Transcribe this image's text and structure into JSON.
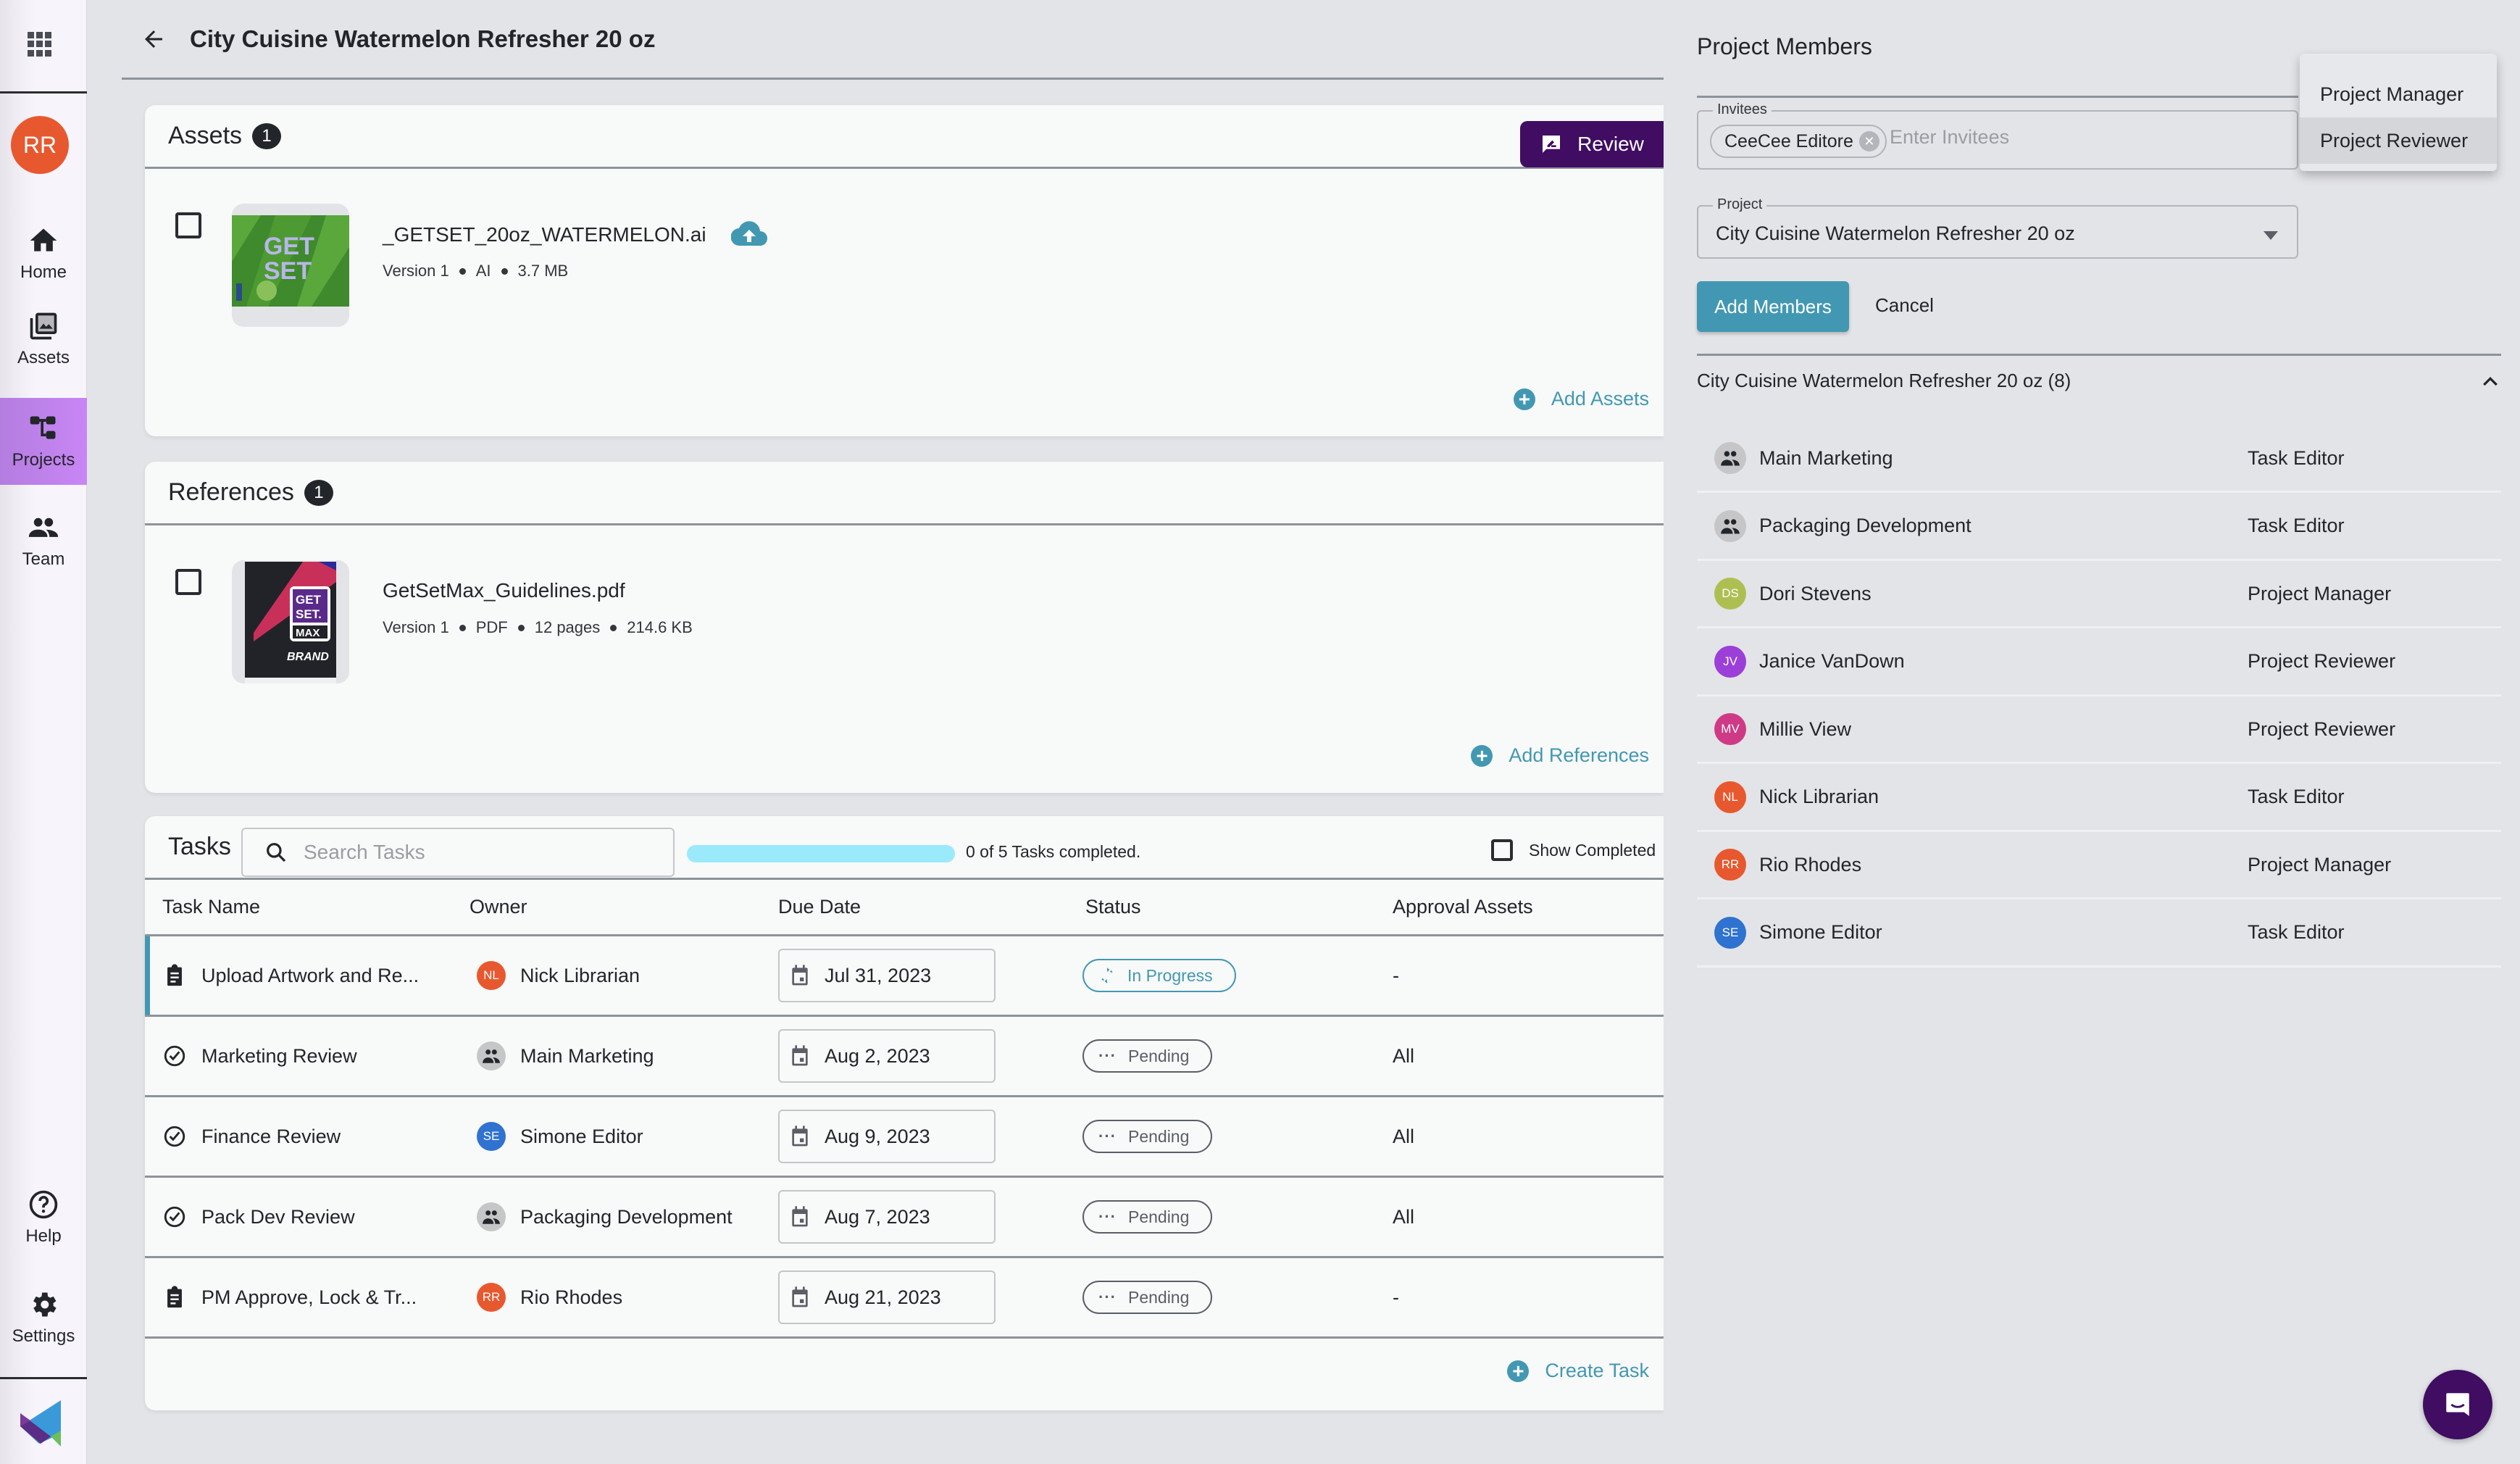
{
  "sidebar": {
    "user_initials": "RR",
    "user_color": "#e8582e",
    "items": [
      {
        "label": "Home",
        "icon": "home-icon"
      },
      {
        "label": "Assets",
        "icon": "images-icon"
      },
      {
        "label": "Projects",
        "icon": "project-tree-icon",
        "active": true
      },
      {
        "label": "Team",
        "icon": "team-icon"
      },
      {
        "label": "Help",
        "icon": "help-icon"
      },
      {
        "label": "Settings",
        "icon": "gear-icon"
      }
    ],
    "accent": "#c886f5"
  },
  "header": {
    "title": "City Cuisine Watermelon Refresher 20 oz"
  },
  "assets": {
    "title": "Assets",
    "count": "1",
    "review_label": "Review",
    "items": [
      {
        "name": "_GETSET_20oz_WATERMELON.ai",
        "meta": [
          "Version 1",
          "AI",
          "3.7 MB"
        ],
        "thumb_text": "GET SET"
      }
    ],
    "add_label": "Add Assets"
  },
  "references": {
    "title": "References",
    "count": "1",
    "items": [
      {
        "name": "GetSetMax_Guidelines.pdf",
        "meta": [
          "Version 1",
          "PDF",
          "12 pages",
          "214.6 KB"
        ],
        "thumb_text": [
          "GET",
          "SET.",
          "MAX",
          "BRAND"
        ]
      }
    ],
    "add_label": "Add References"
  },
  "tasks": {
    "title": "Tasks",
    "search_placeholder": "Search Tasks",
    "search_value": "",
    "completed": 0,
    "total": 5,
    "progress_text": "0 of 5 Tasks completed.",
    "show_completed_label": "Show Completed",
    "columns": [
      "Task Name",
      "Owner",
      "Due Date",
      "Status",
      "Approval Assets"
    ],
    "rows": [
      {
        "name": "Upload Artwork and Re...",
        "icon": "clipboard-icon",
        "owner": "Nick Librarian",
        "owner_initials": "NL",
        "owner_color": "#e8582e",
        "owner_group": false,
        "due": "Jul 31, 2023",
        "status": "In Progress",
        "approval": "-",
        "active": true
      },
      {
        "name": "Marketing Review",
        "icon": "check-circle-icon",
        "owner": "Main Marketing",
        "owner_initials": "",
        "owner_color": "#c6c6c8",
        "owner_group": true,
        "due": "Aug 2, 2023",
        "status": "Pending",
        "approval": "All"
      },
      {
        "name": "Finance Review",
        "icon": "check-circle-icon",
        "owner": "Simone Editor",
        "owner_initials": "SE",
        "owner_color": "#2f72d0",
        "owner_group": false,
        "due": "Aug 9, 2023",
        "status": "Pending",
        "approval": "All"
      },
      {
        "name": "Pack Dev Review",
        "icon": "check-circle-icon",
        "owner": "Packaging Development",
        "owner_initials": "",
        "owner_color": "#c6c6c8",
        "owner_group": true,
        "due": "Aug 7, 2023",
        "status": "Pending",
        "approval": "All"
      },
      {
        "name": "PM Approve, Lock & Tr...",
        "icon": "clipboard-icon",
        "owner": "Rio Rhodes",
        "owner_initials": "RR",
        "owner_color": "#e8582e",
        "owner_group": false,
        "due": "Aug 21, 2023",
        "status": "Pending",
        "approval": "-"
      }
    ],
    "create_label": "Create Task"
  },
  "panel": {
    "title": "Project Members",
    "invitees_label": "Invitees",
    "invitee_chip": "CeeCee Editore",
    "invitees_placeholder": "Enter Invitees",
    "project_label": "Project",
    "project_value": "City Cuisine Watermelon Refresher 20 oz",
    "add_members_label": "Add Members",
    "cancel_label": "Cancel",
    "role_menu": [
      "Project Manager",
      "Project Reviewer"
    ],
    "role_menu_hover": "Project Reviewer",
    "group_title": "City Cuisine Watermelon Refresher 20 oz (8)",
    "members": [
      {
        "name": "Main Marketing",
        "initials": "",
        "color": "#c6c6c8",
        "group": true,
        "role": "Task Editor"
      },
      {
        "name": "Packaging Development",
        "initials": "",
        "color": "#c6c6c8",
        "group": true,
        "role": "Task Editor"
      },
      {
        "name": "Dori Stevens",
        "initials": "DS",
        "color": "#aebf52",
        "group": false,
        "role": "Project Manager"
      },
      {
        "name": "Janice VanDown",
        "initials": "JV",
        "color": "#9b3fd8",
        "group": false,
        "role": "Project Reviewer"
      },
      {
        "name": "Millie View",
        "initials": "MV",
        "color": "#cf3a86",
        "group": false,
        "role": "Project Reviewer"
      },
      {
        "name": "Nick Librarian",
        "initials": "NL",
        "color": "#e8582e",
        "group": false,
        "role": "Task Editor"
      },
      {
        "name": "Rio Rhodes",
        "initials": "RR",
        "color": "#e8582e",
        "group": false,
        "role": "Project Manager"
      },
      {
        "name": "Simone Editor",
        "initials": "SE",
        "color": "#2f72d0",
        "group": false,
        "role": "Task Editor"
      }
    ]
  },
  "colors": {
    "brand_purple": "#400d63",
    "accent_teal": "#4298b2",
    "progress_track": "#9aeafc"
  }
}
